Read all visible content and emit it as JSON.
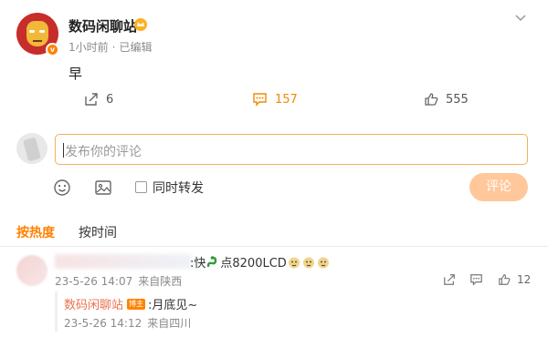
{
  "post": {
    "author": "数码闲聊站",
    "time": "1小时前",
    "edited": "已编辑",
    "text": "早",
    "verified_badge": "v",
    "accent_color": "#ff8200"
  },
  "actions": {
    "repost_count": "6",
    "comment_count": "157",
    "like_count": "555"
  },
  "compose": {
    "placeholder": "发布你的评论",
    "repost_option": "同时转发",
    "submit_label": "评论"
  },
  "tabs": {
    "hot": "按热度",
    "time": "按时间"
  },
  "comment": {
    "text_prefix": ":快",
    "text_suffix": "点8200LCD",
    "date": "23-5-26 14:07",
    "location": "来自陕西",
    "like_count": "12"
  },
  "reply": {
    "author": "数码闲聊站",
    "badge": "博主",
    "text": ":月底见~",
    "date": "23-5-26 14:12",
    "location": "来自四川"
  }
}
